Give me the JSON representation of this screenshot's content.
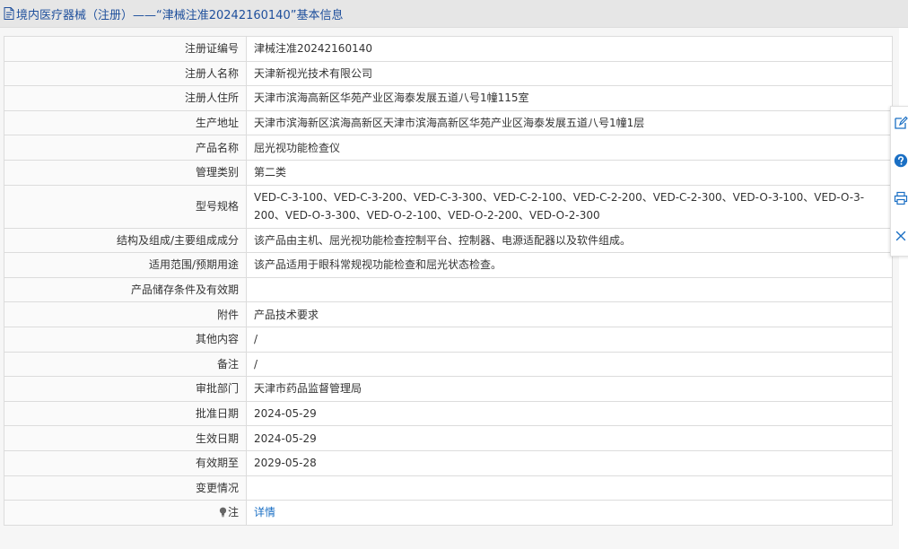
{
  "header": {
    "title": "境内医疗器械（注册）——“津械注准20242160140”基本信息"
  },
  "rows": [
    {
      "label": "注册证编号",
      "value": "津械注准20242160140"
    },
    {
      "label": "注册人名称",
      "value": "天津新视光技术有限公司"
    },
    {
      "label": "注册人住所",
      "value": "天津市滨海高新区华苑产业区海泰发展五道八号1幢115室"
    },
    {
      "label": "生产地址",
      "value": "天津市滨海新区滨海高新区天津市滨海高新区华苑产业区海泰发展五道八号1幢1层"
    },
    {
      "label": "产品名称",
      "value": "屈光视功能检查仪"
    },
    {
      "label": "管理类别",
      "value": "第二类"
    },
    {
      "label": "型号规格",
      "value": "VED-C-3-100、VED-C-3-200、VED-C-3-300、VED-C-2-100、VED-C-2-200、VED-C-2-300、VED-O-3-100、VED-O-3-200、VED-O-3-300、VED-O-2-100、VED-O-2-200、VED-O-2-300"
    },
    {
      "label": "结构及组成/主要组成成分",
      "value": "该产品由主机、屈光视功能检查控制平台、控制器、电源适配器以及软件组成。"
    },
    {
      "label": "适用范围/预期用途",
      "value": "该产品适用于眼科常规视功能检查和屈光状态检查。"
    },
    {
      "label": "产品储存条件及有效期",
      "value": ""
    },
    {
      "label": "附件",
      "value": "产品技术要求"
    },
    {
      "label": "其他内容",
      "value": "/"
    },
    {
      "label": "备注",
      "value": "/"
    },
    {
      "label": "审批部门",
      "value": "天津市药品监督管理局"
    },
    {
      "label": "批准日期",
      "value": "2024-05-29"
    },
    {
      "label": "生效日期",
      "value": "2024-05-29"
    },
    {
      "label": "有效期至",
      "value": "2029-05-28"
    },
    {
      "label": "变更情况",
      "value": ""
    },
    {
      "label": "注",
      "value": "详情"
    }
  ],
  "sidebar": {
    "icons": [
      "edit-icon",
      "help-icon",
      "print-icon",
      "close-icon"
    ]
  },
  "colors": {
    "title": "#1e4f9c",
    "link": "#1a6fc4",
    "help": "#1a6fc4"
  }
}
